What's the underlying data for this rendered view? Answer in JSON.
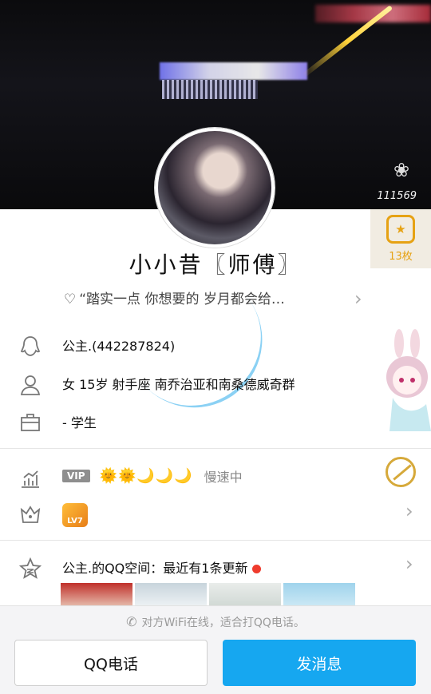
{
  "cover": {
    "visit_count": "111569",
    "flower_icon": "flower-icon"
  },
  "medal": {
    "count": "13枚",
    "icon": "star-badge-icon"
  },
  "profile": {
    "nickname": "小小昔〖师傅〗",
    "signature": "“踏实一点 你想要的 岁月都会给…",
    "heart_icon": "♡"
  },
  "info": {
    "qq_line": "公主.(442287824)",
    "details": "女  15岁  射手座  南乔治亚和南桑德威奇群",
    "job": "- 学生"
  },
  "vip": {
    "badge": "VIP",
    "level_icons": "🌞🌞🌙🌙🌙",
    "status": "慢速中"
  },
  "level_badge": "LV7",
  "qzone": {
    "text": "公主.的QQ空间：最近有1条更新"
  },
  "bottom": {
    "hint": "对方WiFi在线，适合打QQ电话。",
    "call_label": "QQ电话",
    "message_label": "发消息"
  },
  "colors": {
    "accent_blue": "#16a7f0",
    "medal_gold": "#e6a214",
    "update_dot": "#ef3b2d"
  }
}
